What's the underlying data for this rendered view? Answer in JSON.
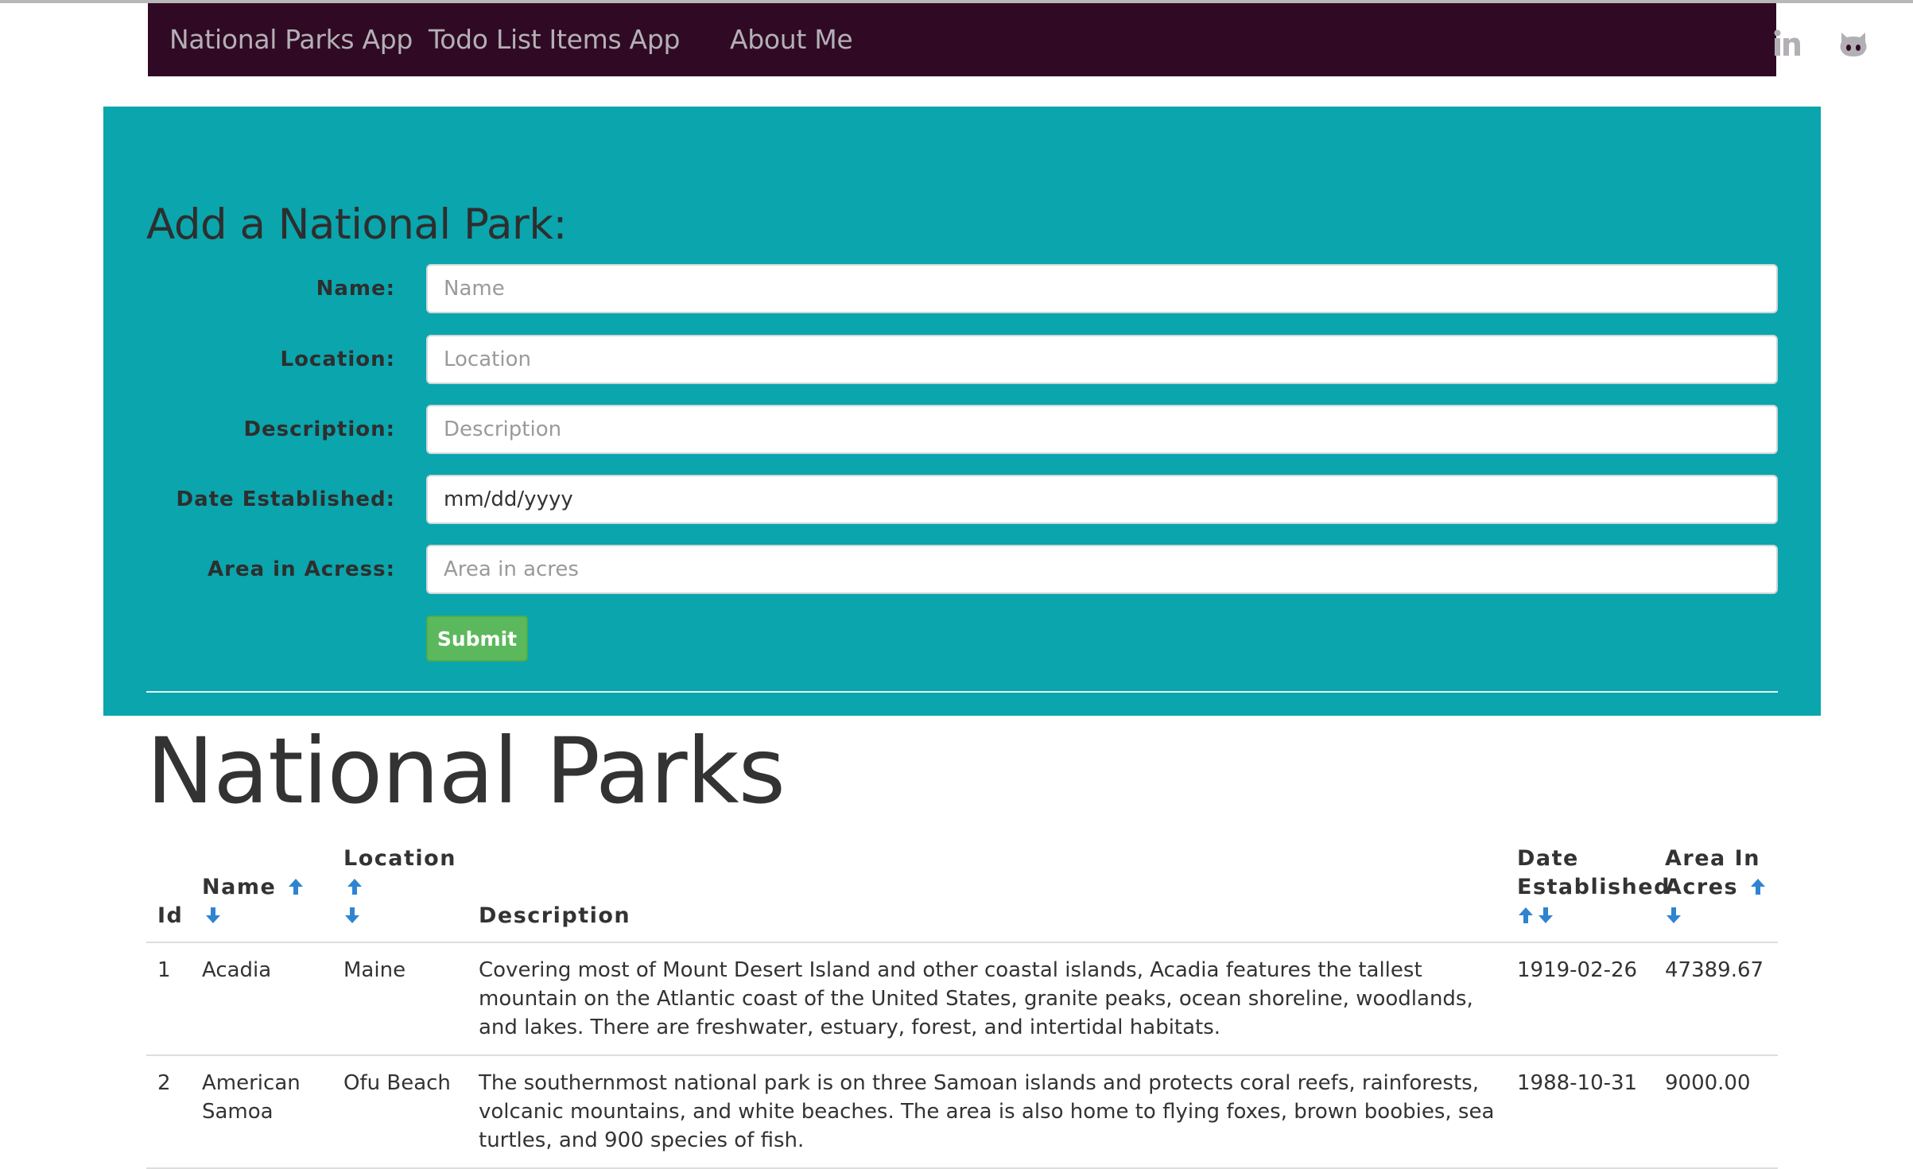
{
  "nav": {
    "links": [
      "National Parks App",
      "Todo List Items App",
      "About Me"
    ],
    "icons": [
      "linkedin-icon",
      "github-icon"
    ]
  },
  "form": {
    "title": "Add a National Park:",
    "fields": [
      {
        "label": "Name:",
        "placeholder": "Name",
        "value": ""
      },
      {
        "label": "Location:",
        "placeholder": "Location",
        "value": ""
      },
      {
        "label": "Description:",
        "placeholder": "Description",
        "value": ""
      },
      {
        "label": "Date Established:",
        "placeholder": "mm/dd/yyyy",
        "value": ""
      },
      {
        "label": "Area in Acress:",
        "placeholder": "Area in acres",
        "value": ""
      }
    ],
    "submit_label": "Submit"
  },
  "table": {
    "heading": "National Parks",
    "columns": {
      "id": "Id",
      "name": "Name",
      "location": "Location",
      "description": "Description",
      "date_line1": "Date",
      "date_line2": "Established",
      "area_line1": "Area In",
      "area_line2": "Acres"
    },
    "rows": [
      {
        "id": "1",
        "name": "Acadia",
        "location": "Maine",
        "description": "Covering most of Mount Desert Island and other coastal islands, Acadia features the tallest mountain on the Atlantic coast of the United States, granite peaks, ocean shoreline, woodlands, and lakes. There are freshwater, estuary, forest, and intertidal habitats.",
        "date": "1919-02-26",
        "area": "47389.67"
      },
      {
        "id": "2",
        "name": "American Samoa",
        "location": "Ofu Beach",
        "description": "The southernmost national park is on three Samoan islands and protects coral reefs, rainforests, volcanic mountains, and white beaches. The area is also home to flying foxes, brown boobies, sea turtles, and 900 species of fish.",
        "date": "1988-10-31",
        "area": "9000.00"
      }
    ]
  },
  "colors": {
    "navbar_bg": "#300a24",
    "nav_text": "#b3b0b5",
    "jumbotron_bg": "#0aa5ad",
    "submit_bg": "#5cb85c",
    "sort_arrow": "#2f84d1"
  }
}
